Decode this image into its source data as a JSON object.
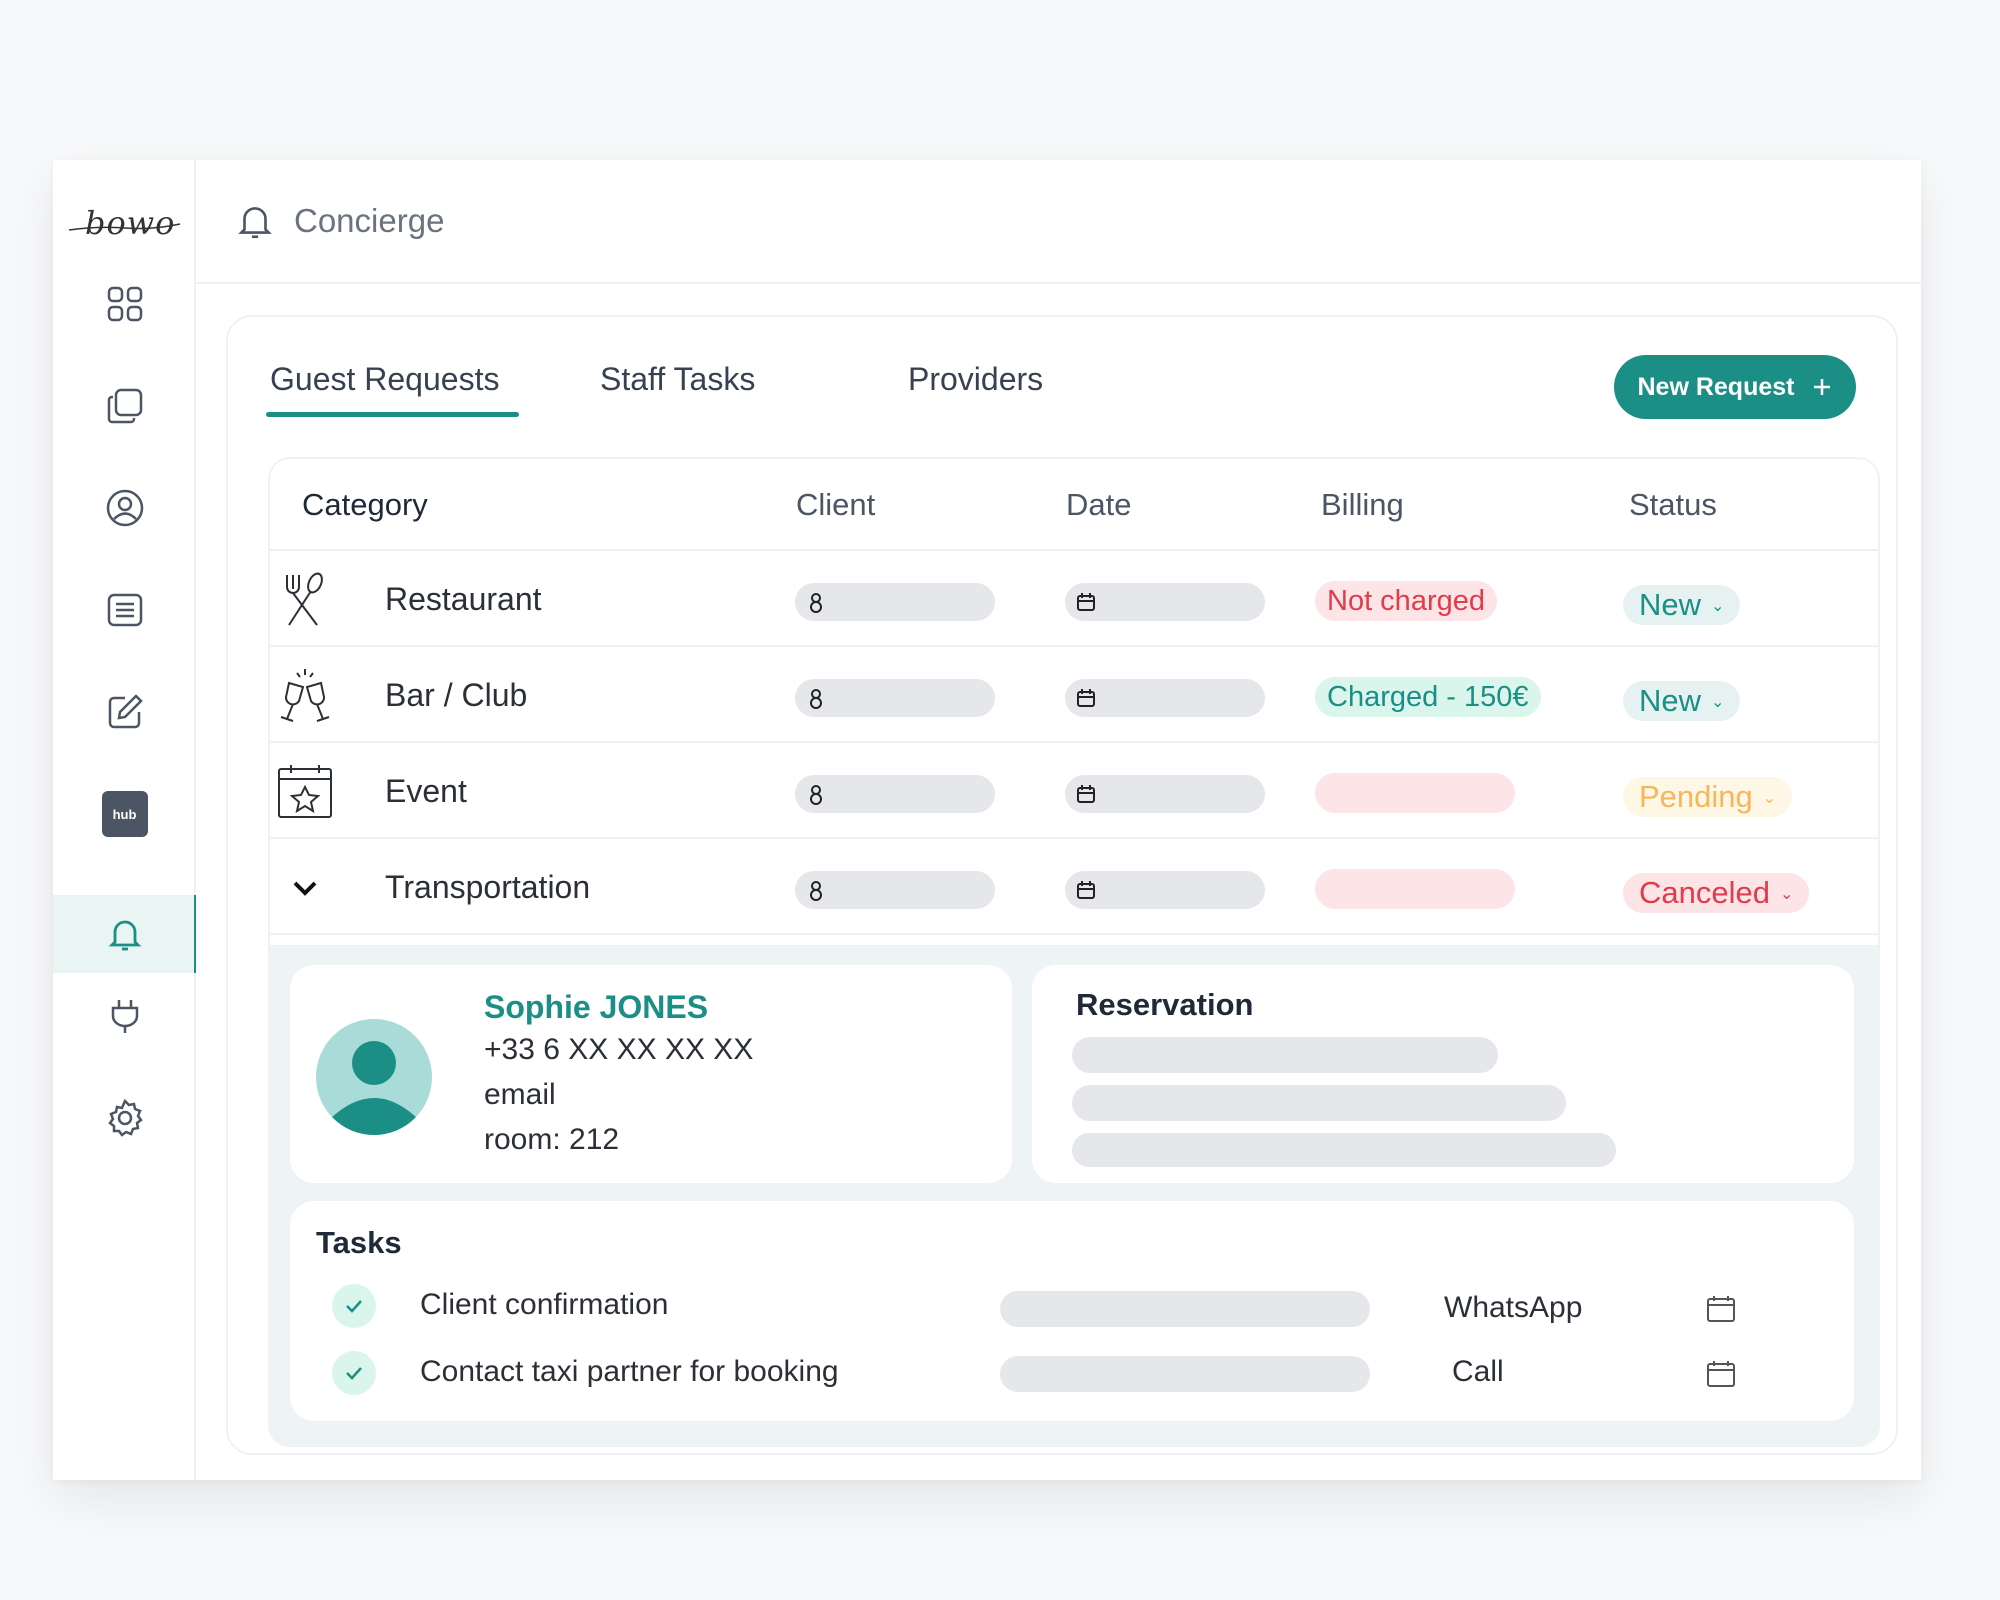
{
  "app": {
    "logo_text": "bowo",
    "page_title": "Concierge"
  },
  "sidebar": {
    "items": [
      {
        "name": "dashboard",
        "icon": "grid-icon"
      },
      {
        "name": "pages",
        "icon": "copy-icon"
      },
      {
        "name": "guests",
        "icon": "user-circle-icon"
      },
      {
        "name": "lists",
        "icon": "list-icon"
      },
      {
        "name": "edit",
        "icon": "edit-icon"
      },
      {
        "name": "hub",
        "icon": "hub-icon",
        "label": "hub"
      },
      {
        "name": "concierge",
        "icon": "bell-icon",
        "active": true
      },
      {
        "name": "integrations",
        "icon": "plug-icon"
      },
      {
        "name": "settings",
        "icon": "gear-icon"
      }
    ]
  },
  "tabs": [
    {
      "label": "Guest Requests",
      "active": true
    },
    {
      "label": "Staff Tasks"
    },
    {
      "label": "Providers"
    }
  ],
  "new_request_button": {
    "label": "New Request",
    "icon": "plus-icon"
  },
  "table": {
    "columns": [
      "Category",
      "Client",
      "Date",
      "Billing",
      "Status"
    ],
    "rows": [
      {
        "category": "Restaurant",
        "icon": "fork-spoon-icon",
        "billing": "Not charged",
        "billing_style": "red",
        "status": "New",
        "status_style": "new"
      },
      {
        "category": "Bar / Club",
        "icon": "cheers-icon",
        "billing": "Charged - 150€",
        "billing_style": "green",
        "status": "New",
        "status_style": "new"
      },
      {
        "category": "Event",
        "icon": "calendar-star-icon",
        "billing": "",
        "billing_style": "empty",
        "status": "Pending",
        "status_style": "pending"
      },
      {
        "category": "Transportation",
        "icon": "chevron-down-icon",
        "billing": "",
        "billing_style": "empty",
        "status": "Canceled",
        "status_style": "canceled"
      }
    ]
  },
  "client": {
    "name": "Sophie JONES",
    "phone": "+33 6 XX XX XX XX",
    "email": "email",
    "room": "room: 212"
  },
  "reservation": {
    "title": "Reservation"
  },
  "tasks": {
    "title": "Tasks",
    "items": [
      {
        "label": "Client confirmation",
        "channel": "WhatsApp"
      },
      {
        "label": "Contact taxi partner for booking",
        "channel": "Call"
      }
    ]
  },
  "colors": {
    "accent": "#1b8f86",
    "danger": "#e23b4a",
    "warning": "#f5b75a"
  }
}
